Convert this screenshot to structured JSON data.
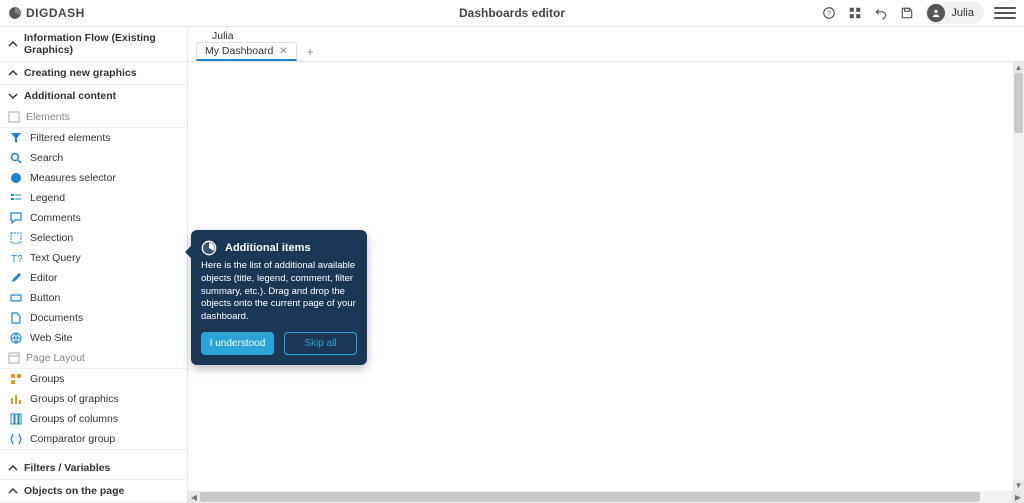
{
  "header": {
    "logo_text": "DIGDASH",
    "title": "Dashboards editor",
    "user_name": "Julia"
  },
  "sidebar": {
    "sections": {
      "info_flow": "Information Flow (Existing Graphics)",
      "creating": "Creating new graphics",
      "additional": "Additional content",
      "filters": "Filters / Variables",
      "objects": "Objects on the page"
    },
    "group_elements": "Elements",
    "group_page_layout": "Page Layout",
    "elements": [
      {
        "label": "Filtered elements"
      },
      {
        "label": "Search"
      },
      {
        "label": "Measures selector"
      },
      {
        "label": "Legend"
      },
      {
        "label": "Comments"
      },
      {
        "label": "Selection"
      },
      {
        "label": "Text Query"
      },
      {
        "label": "Editor"
      },
      {
        "label": "Button"
      },
      {
        "label": "Documents"
      },
      {
        "label": "Web Site"
      }
    ],
    "page_layout": [
      {
        "label": "Groups"
      },
      {
        "label": "Groups of graphics"
      },
      {
        "label": "Groups of columns"
      },
      {
        "label": "Comparator group"
      }
    ]
  },
  "main": {
    "breadcrumb": "Julia",
    "tab_label": "My Dashboard"
  },
  "popover": {
    "title": "Additional items",
    "body": "Here is the list of additional available objects (title, legend, comment, filter summary, etc.). Drag and drop the objects onto the current page of your dashboard.",
    "primary": "I understood",
    "secondary": "Skip all"
  }
}
